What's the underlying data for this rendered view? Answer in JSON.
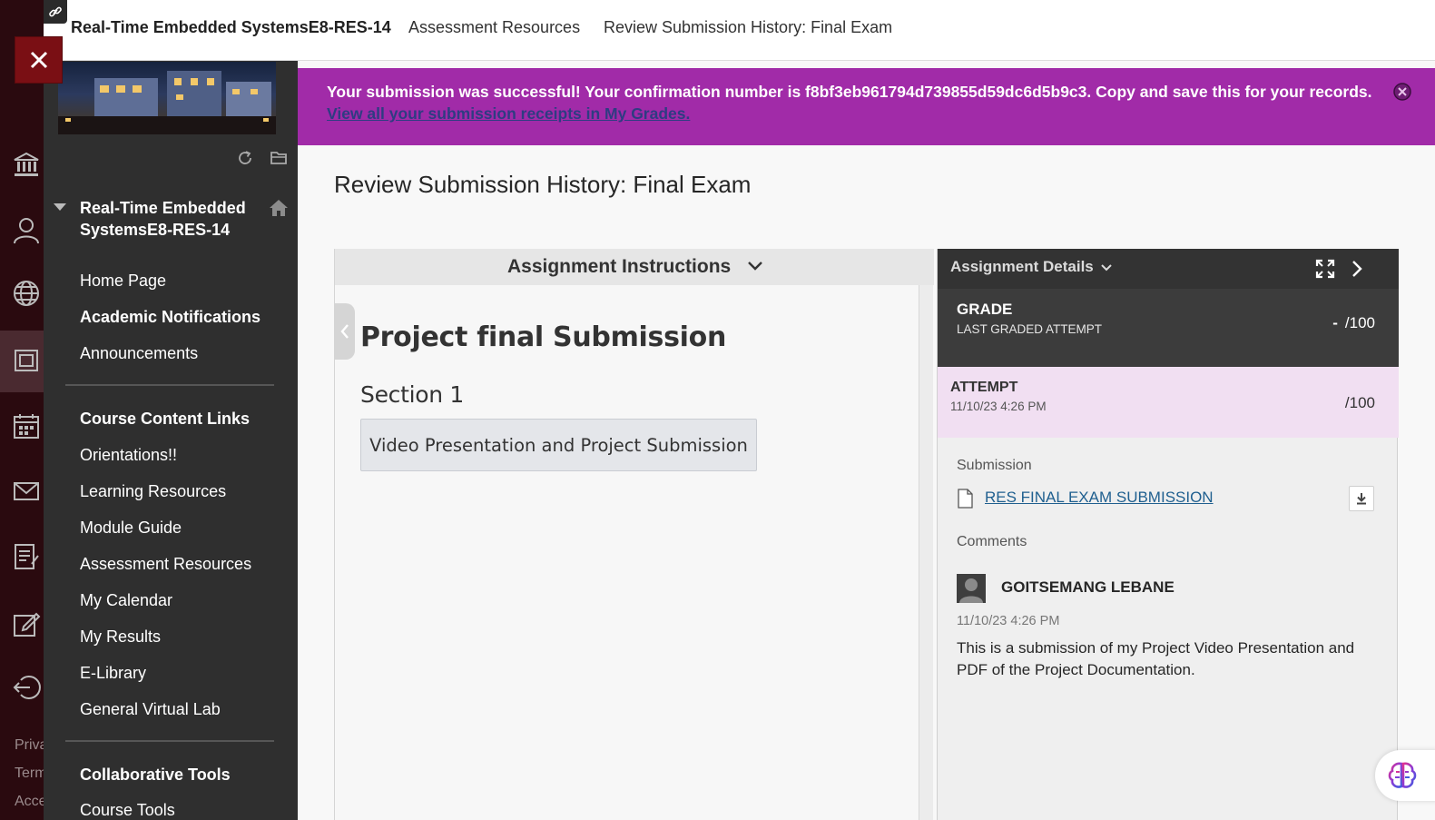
{
  "topbar": {
    "course": "Real-Time Embedded SystemsE8-RES-14",
    "crumb_assessment": "Assessment Resources",
    "crumb_current": "Review Submission History: Final Exam"
  },
  "rail": {
    "footer": [
      "Priva",
      "Term",
      "Acce"
    ]
  },
  "sidebar": {
    "course_title": "Real-Time Embedded SystemsE8-RES-14",
    "items": [
      {
        "label": "Home Page",
        "bold": false
      },
      {
        "label": "Academic Notifications",
        "bold": true
      },
      {
        "label": "Announcements",
        "bold": false
      },
      {
        "label": "Course Content Links",
        "bold": true
      },
      {
        "label": "Orientations!!",
        "bold": false
      },
      {
        "label": "Learning Resources",
        "bold": false
      },
      {
        "label": "Module Guide",
        "bold": false
      },
      {
        "label": "Assessment Resources",
        "bold": false
      },
      {
        "label": "My Calendar",
        "bold": false
      },
      {
        "label": "My Results",
        "bold": false
      },
      {
        "label": "E-Library",
        "bold": false
      },
      {
        "label": "General Virtual Lab",
        "bold": false
      },
      {
        "label": "Collaborative Tools",
        "bold": true
      },
      {
        "label": "Course Tools",
        "bold": false
      }
    ]
  },
  "success": {
    "message": "Your submission was successful! Your confirmation number is f8bf3eb961794d739855d59dc6d5b9c3. Copy and save this for your records.",
    "link": "View all your submission receipts in My Grades."
  },
  "page_title": "Review Submission History: Final Exam",
  "instructions": {
    "header": "Assignment Instructions",
    "title": "Project final Submission",
    "section": "Section 1",
    "button": "Video Presentation and Project Submission"
  },
  "details": {
    "header": "Assignment Details",
    "grade_label": "GRADE",
    "grade_sub": "LAST GRADED ATTEMPT",
    "grade_dash": "-",
    "grade_max": "/100",
    "attempt_label": "ATTEMPT",
    "attempt_date": "11/10/23 4:26 PM",
    "attempt_max": "/100",
    "submission_label": "Submission",
    "file_name": "RES FINAL EXAM SUBMISSION",
    "comments_label": "Comments",
    "commenter": "GOITSEMANG LEBANE",
    "comment_date": "11/10/23 4:26 PM",
    "comment_text": "This is a submission of my Project Video Presentation and PDF of the Project Documentation."
  },
  "colors": {
    "success_bg": "#a12ba8",
    "rail_bg": "#2a0a0f",
    "sidebar_bg": "#2f2f2f",
    "close_bg": "#7a0f14",
    "attempt_bg": "#f1dff2"
  },
  "icons": [
    "link-icon",
    "close-icon",
    "institution-icon",
    "user-icon",
    "globe-icon",
    "courses-icon",
    "calendar-icon",
    "mail-icon",
    "grades-icon",
    "edit-icon",
    "signout-icon",
    "refresh-icon",
    "folder-icon",
    "home-icon",
    "expand-icon",
    "chevron-right-icon",
    "file-icon",
    "download-icon",
    "brain-icon"
  ]
}
